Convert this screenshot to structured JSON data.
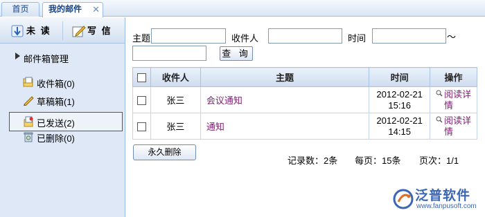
{
  "tabs": [
    {
      "label": "首页"
    },
    {
      "label": "我的邮件",
      "close": "✕"
    }
  ],
  "toolbar": {
    "unread_label": "未 读",
    "write_label": "写 信"
  },
  "tree": {
    "root_label": "邮件箱管理",
    "folders": [
      {
        "label": "收件箱(0)",
        "icon": "inbox-icon"
      },
      {
        "label": "草稿箱(1)",
        "icon": "drafts-icon"
      },
      {
        "label": "已发送(2)",
        "icon": "sent-icon"
      },
      {
        "label": "已删除(0)",
        "icon": "trash-icon"
      }
    ]
  },
  "search": {
    "subject_label": "主题",
    "subject_value": "",
    "recipient_label": "收件人",
    "recipient_value": "",
    "time_label": "时间",
    "time_from": "",
    "time_sep": "～",
    "time_to": "",
    "button_label": "查 询"
  },
  "table": {
    "headers": [
      "",
      "收件人",
      "主题",
      "时间",
      "操作"
    ],
    "rows": [
      {
        "recipient": "张三",
        "subject": "会议通知",
        "date": "2012-02-21",
        "time": "15:16",
        "action_line1": "阅读详",
        "action_line2": "情"
      },
      {
        "recipient": "张三",
        "subject": "通知",
        "date": "2012-02-21",
        "time": "14:15",
        "action_line1": "阅读详",
        "action_line2": "情"
      }
    ]
  },
  "footer": {
    "delete_label": "永久删除",
    "record_count": "记录数：2条",
    "per_page": "每页：15条",
    "page_num": "页次：1/1"
  },
  "logo": {
    "brand": "泛普软件",
    "url": "www.fanpusoft.com"
  }
}
